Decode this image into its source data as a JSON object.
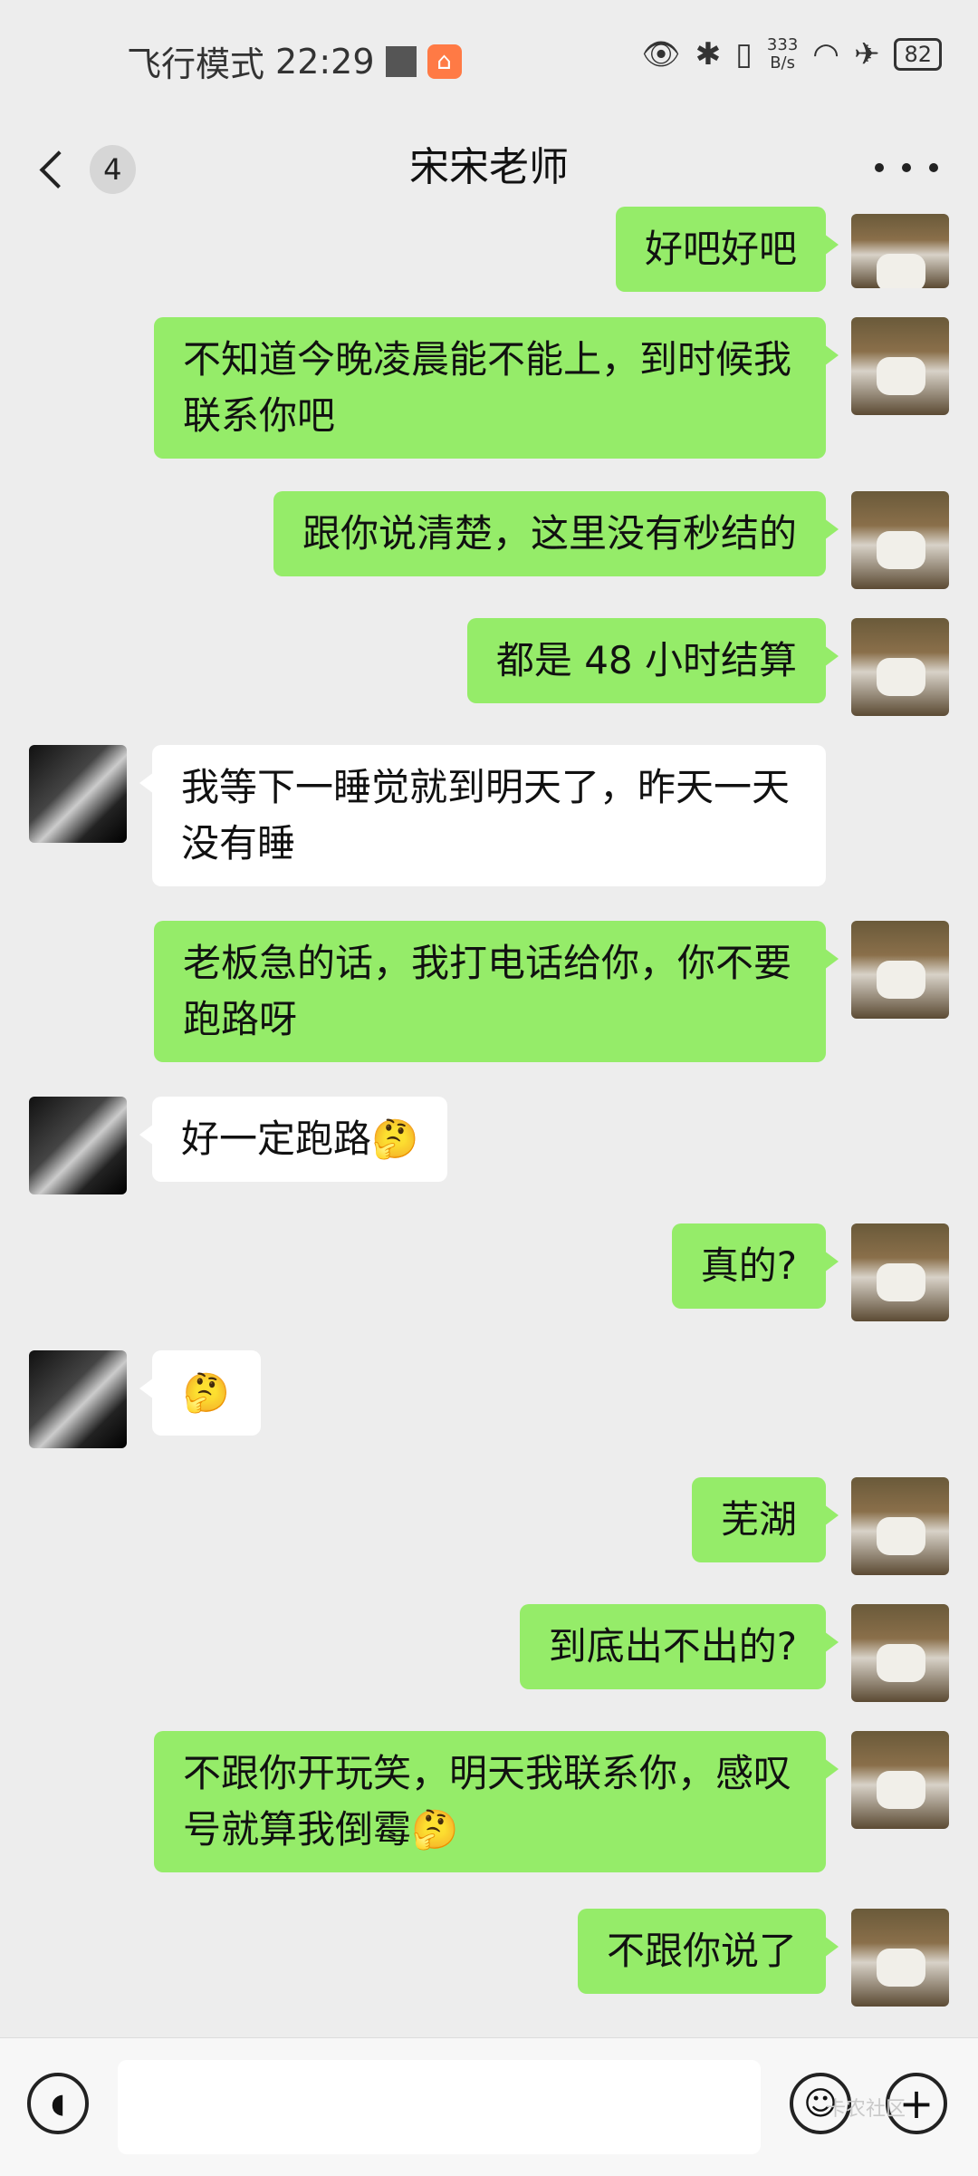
{
  "status_bar": {
    "mode": "飞行模式",
    "time": "22:29",
    "speed_value": "333",
    "speed_unit": "B/s",
    "battery": "82"
  },
  "header": {
    "unread_count": "4",
    "title": "宋宋老师"
  },
  "messages": [
    {
      "from": "self",
      "text": "好吧好吧"
    },
    {
      "from": "self",
      "text": "不知道今晚凌晨能不能上，到时候我联系你吧"
    },
    {
      "from": "self",
      "text": "跟你说清楚，这里没有秒结的"
    },
    {
      "from": "self",
      "text": "都是 48 小时结算"
    },
    {
      "from": "other",
      "text": "我等下一睡觉就到明天了，昨天一天没有睡"
    },
    {
      "from": "self",
      "text": "老板急的话，我打电话给你，你不要跑路呀"
    },
    {
      "from": "other",
      "text": "好一定跑路🤔"
    },
    {
      "from": "self",
      "text": "真的?"
    },
    {
      "from": "other",
      "text": "🤔"
    },
    {
      "from": "self",
      "text": "芜湖"
    },
    {
      "from": "self",
      "text": "到底出不出的?"
    },
    {
      "from": "self",
      "text": "不跟你开玩笑，明天我联系你，感叹号就算我倒霉🤔"
    },
    {
      "from": "self",
      "text": "不跟你说了"
    }
  ],
  "input_bar": {
    "watermark": "卡农社区"
  }
}
